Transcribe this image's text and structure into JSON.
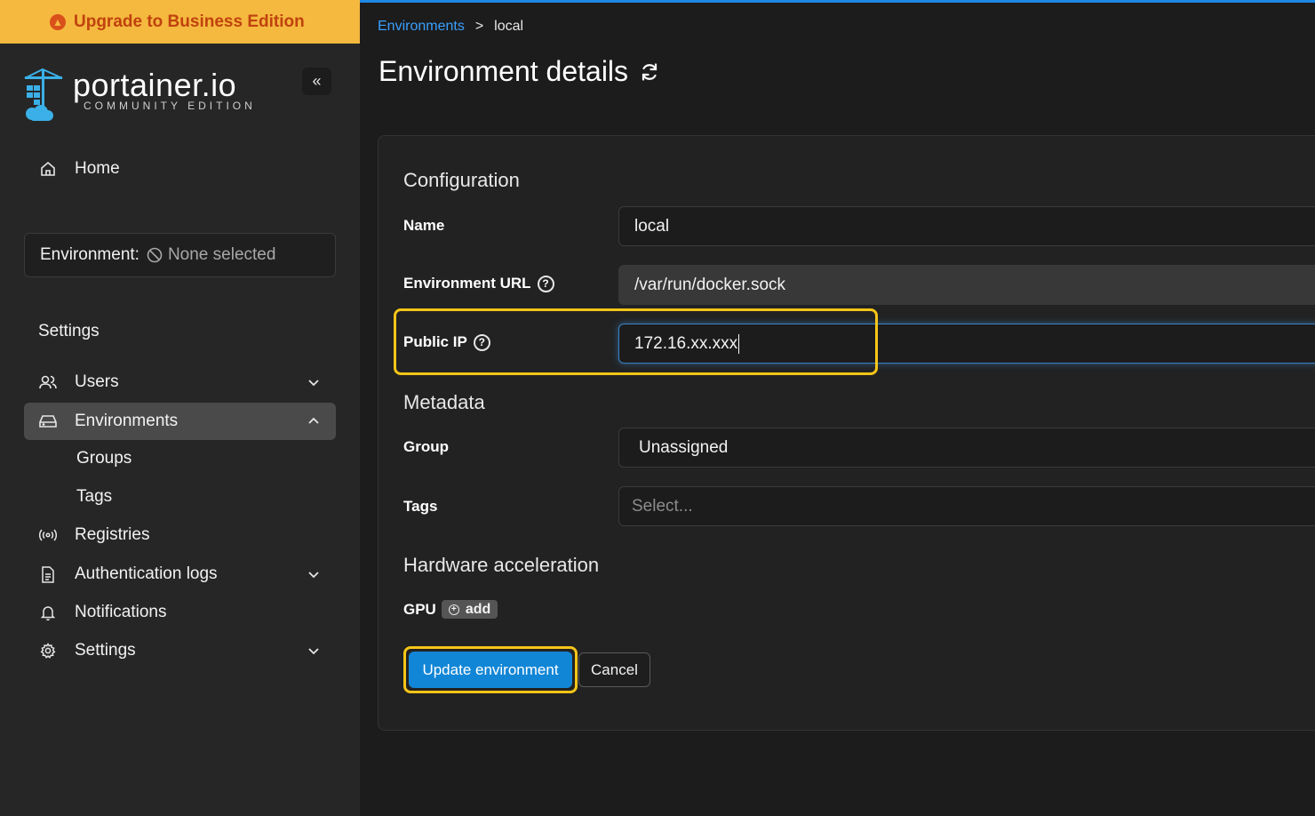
{
  "upgrade_banner": {
    "label": "Upgrade to Business Edition"
  },
  "logo": {
    "name": "portainer.io",
    "edition": "COMMUNITY EDITION"
  },
  "sidebar": {
    "home": "Home",
    "environment": {
      "label": "Environment:",
      "value": "None selected"
    },
    "section_title": "Settings",
    "items": {
      "users": "Users",
      "environments": "Environments",
      "groups": "Groups",
      "tags": "Tags",
      "registries": "Registries",
      "auth_logs": "Authentication logs",
      "notifications": "Notifications",
      "settings": "Settings"
    }
  },
  "breadcrumb": {
    "parent": "Environments",
    "separator": ">",
    "current": "local"
  },
  "page": {
    "title": "Environment details"
  },
  "form": {
    "configuration": {
      "title": "Configuration",
      "name_label": "Name",
      "name_value": "local",
      "url_label": "Environment URL",
      "url_value": "/var/run/docker.sock",
      "public_ip_label": "Public IP",
      "public_ip_value": "172.16.xx.xxx"
    },
    "metadata": {
      "title": "Metadata",
      "group_label": "Group",
      "group_value": "Unassigned",
      "tags_label": "Tags",
      "tags_placeholder": "Select..."
    },
    "hardware": {
      "title": "Hardware acceleration",
      "gpu_label": "GPU",
      "gpu_add": "add"
    },
    "actions": {
      "update": "Update environment",
      "cancel": "Cancel"
    }
  },
  "colors": {
    "accent": "#1286d6",
    "highlight": "#f5c518",
    "banner": "#f5b93f",
    "link": "#3aa0ff"
  }
}
